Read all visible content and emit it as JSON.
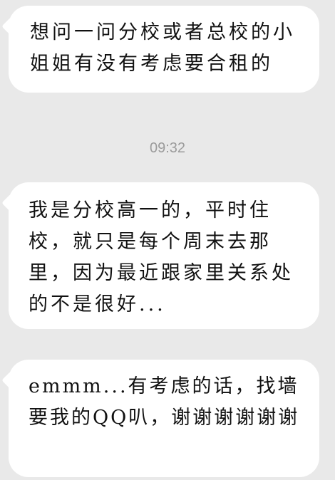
{
  "messages": [
    {
      "text": "想问一问分校或者总校的小姐姐有没有考虑要合租的"
    },
    {
      "text": "我是分校高一的，平时住校，就只是每个周末去那里，因为最近跟家里关系处的不是很好..."
    },
    {
      "text": "emmm...有考虑的话，找墙要我的QQ叭，谢谢谢谢谢谢"
    }
  ],
  "timestamp": "09:32",
  "colors": {
    "background": "#e9e9e9",
    "bubble": "#ffffff",
    "timestamp": "#9b9b9b",
    "text": "#111111"
  }
}
